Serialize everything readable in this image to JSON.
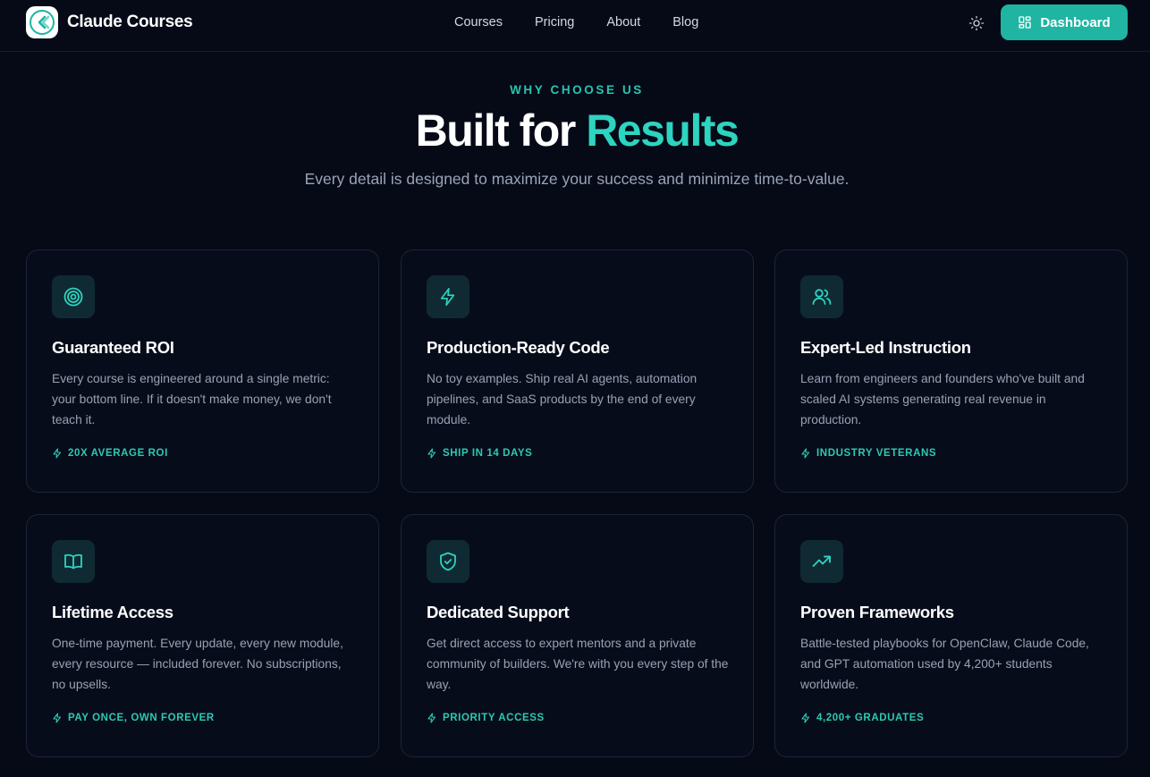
{
  "brand": {
    "name": "Claude Courses",
    "accent": "#2dd4bf"
  },
  "nav": {
    "links": [
      "Courses",
      "Pricing",
      "About",
      "Blog"
    ],
    "theme_icon": "sun-icon",
    "dashboard_label": "Dashboard"
  },
  "hero": {
    "eyebrow": "WHY CHOOSE US",
    "title_main": "Built for ",
    "title_accent": "Results",
    "subtitle": "Every detail is designed to maximize your success and minimize time-to-value."
  },
  "features": [
    {
      "icon": "target-icon",
      "title": "Guaranteed ROI",
      "description": "Every course is engineered around a single metric: your bottom line. If it doesn't make money, we don't teach it.",
      "tag": "20X AVERAGE ROI"
    },
    {
      "icon": "lightning-icon",
      "title": "Production-Ready Code",
      "description": "No toy examples. Ship real AI agents, automation pipelines, and SaaS products by the end of every module.",
      "tag": "SHIP IN 14 DAYS"
    },
    {
      "icon": "users-icon",
      "title": "Expert-Led Instruction",
      "description": "Learn from engineers and founders who've built and scaled AI systems generating real revenue in production.",
      "tag": "INDUSTRY VETERANS"
    },
    {
      "icon": "book-icon",
      "title": "Lifetime Access",
      "description": "One-time payment. Every update, every new module, every resource — included forever. No subscriptions, no upsells.",
      "tag": "PAY ONCE, OWN FOREVER"
    },
    {
      "icon": "shield-check-icon",
      "title": "Dedicated Support",
      "description": "Get direct access to expert mentors and a private community of builders. We're with you every step of the way.",
      "tag": "PRIORITY ACCESS"
    },
    {
      "icon": "trending-up-icon",
      "title": "Proven Frameworks",
      "description": "Battle-tested playbooks for OpenClaw, Claude Code, and GPT automation used by 4,200+ students worldwide.",
      "tag": "4,200+ GRADUATES"
    }
  ]
}
